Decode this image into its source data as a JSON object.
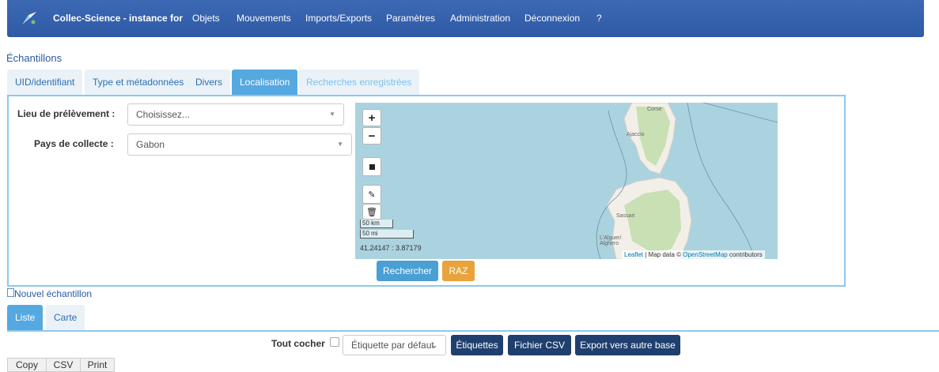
{
  "navbar": {
    "brand": "Collec-Science - instance for",
    "items": [
      "Objets",
      "Mouvements",
      "Imports/Exports",
      "Paramètres",
      "Administration",
      "Déconnexion",
      "?"
    ]
  },
  "page_title": "Échantillons",
  "tabs": [
    "UID/identifiant",
    "Type et métadonnées",
    "Divers",
    "Localisation",
    "Recherches enregistrées"
  ],
  "active_tab": "Localisation",
  "form": {
    "lieu_label": "Lieu de prélèvement :",
    "lieu_value": "Choisissez...",
    "pays_label": "Pays de collecte :",
    "pays_value": "Gabon"
  },
  "map": {
    "zoom_in": "+",
    "zoom_out": "−",
    "scale_km": "50 km",
    "scale_mi": "50 mi",
    "coords": "41.24147 : 3.87179",
    "places": [
      "Corse",
      "Ajaccio",
      "Sassari",
      "L'Alguer/",
      "Alghero"
    ],
    "attribution_leaflet": "Leaflet",
    "attribution_text": " | Map data © ",
    "attribution_osm": "OpenStreetMap",
    "attribution_tail": " contributors",
    "colors": {
      "sea": "#aad3df",
      "land": "#f2efe9",
      "green": "#c8e0b4"
    }
  },
  "buttons": {
    "search": "Rechercher",
    "reset": "RAZ"
  },
  "new_sample": "Nouvel échantillon",
  "view_tabs": [
    "Liste",
    "Carte"
  ],
  "list_toolbar": {
    "check_all": "Tout cocher",
    "label_select": "Étiquette par défaut",
    "labels_btn": "Étiquettes",
    "csv_btn": "Fichier CSV",
    "export_btn": "Export vers autre base"
  },
  "dt_buttons": [
    "Copy",
    "CSV",
    "Print"
  ],
  "colors": {
    "navbar": "#2f5aa6",
    "tab_active": "#55a9e0",
    "search_btn": "#4a9fd4",
    "reset_btn": "#e8a33c",
    "dark_btn": "#1f3f6e"
  }
}
